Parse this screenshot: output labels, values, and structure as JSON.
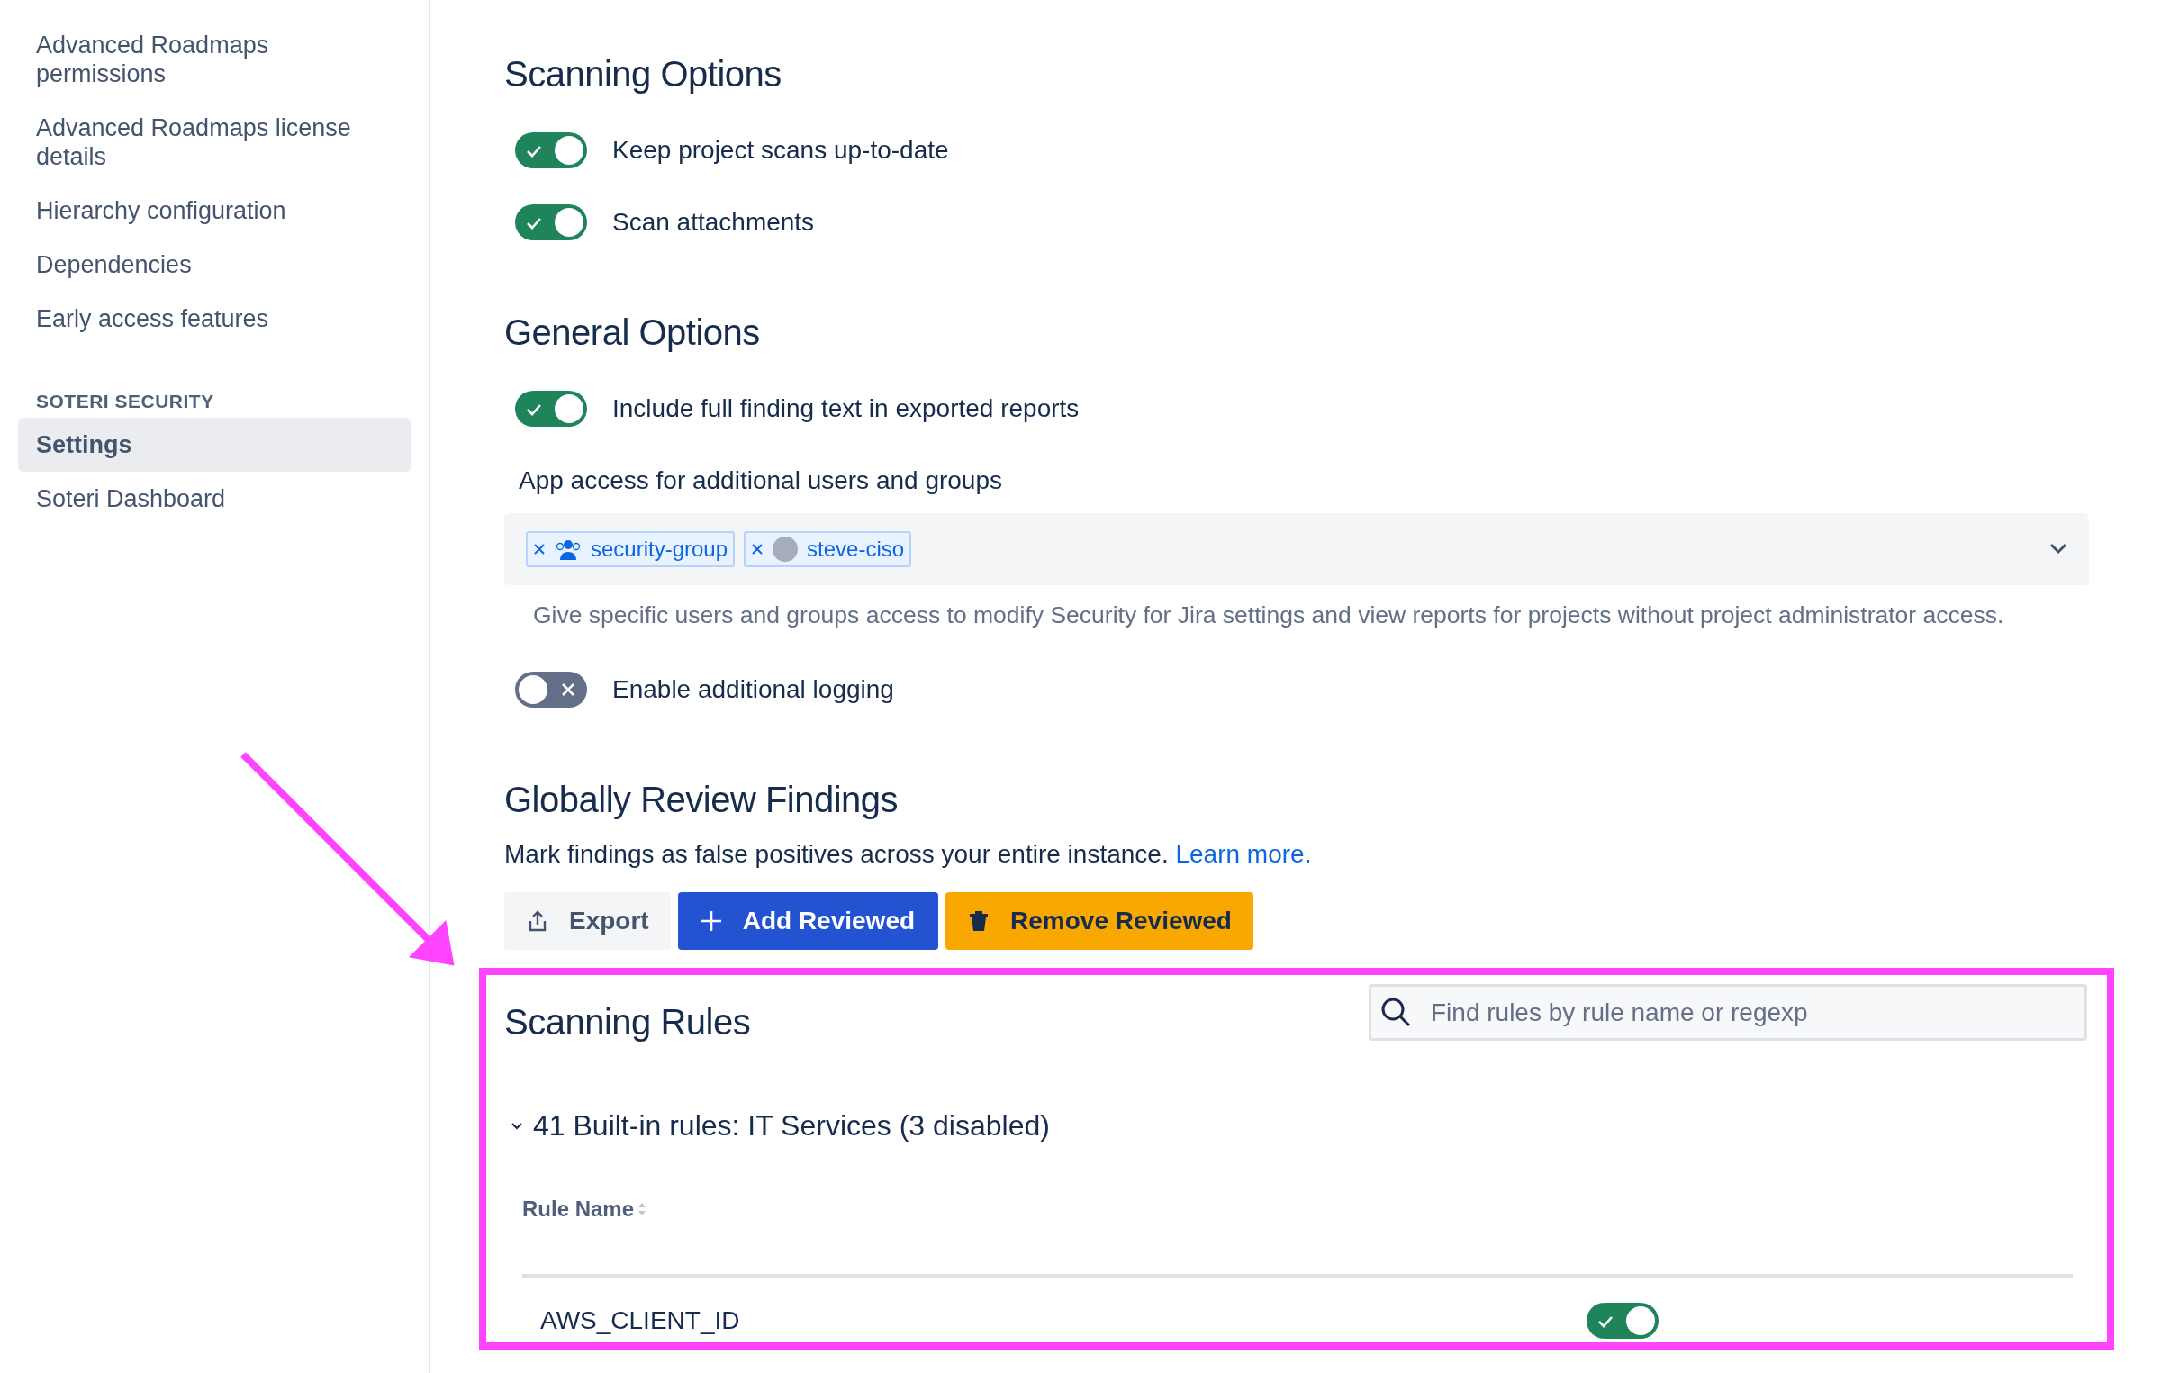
{
  "sidebar": {
    "sections": [
      {
        "items": [
          {
            "label": "Advanced Roadmaps permissions",
            "selected": false
          },
          {
            "label": "Advanced Roadmaps license details",
            "selected": false
          },
          {
            "label": "Hierarchy configuration",
            "selected": false
          },
          {
            "label": "Dependencies",
            "selected": false
          },
          {
            "label": "Early access features",
            "selected": false
          }
        ]
      },
      {
        "heading": "SOTERI SECURITY",
        "items": [
          {
            "label": "Settings",
            "selected": true
          },
          {
            "label": "Soteri Dashboard",
            "selected": false
          }
        ]
      }
    ]
  },
  "scanning_options": {
    "title": "Scanning Options",
    "toggles": [
      {
        "label": "Keep project scans up-to-date",
        "on": true
      },
      {
        "label": "Scan attachments",
        "on": true
      }
    ]
  },
  "general_options": {
    "title": "General Options",
    "toggle": {
      "label": "Include full finding text in exported reports",
      "on": true
    },
    "access": {
      "label": "App access for additional users and groups",
      "tags": [
        {
          "kind": "group",
          "label": "security-group"
        },
        {
          "kind": "user",
          "label": "steve-ciso"
        }
      ],
      "help": "Give specific users and groups access to modify Security for Jira settings and view reports for projects without project administrator access."
    },
    "logging": {
      "label": "Enable additional logging",
      "on": false
    }
  },
  "review": {
    "title": "Globally Review Findings",
    "text": "Mark findings as false positives across your entire instance.",
    "link": "Learn more.",
    "buttons": [
      {
        "kind": "default",
        "label": "Export"
      },
      {
        "kind": "primary",
        "label": "Add Reviewed"
      },
      {
        "kind": "warning",
        "label": "Remove Reviewed"
      }
    ]
  },
  "rules": {
    "title": "Scanning Rules",
    "search": {
      "placeholder": "Find rules by rule name or regexp"
    },
    "group": {
      "title": "41 Built-in rules: IT Services (3 disabled)",
      "expanded": true
    },
    "columns": [
      "Rule Name"
    ],
    "rows": [
      {
        "name": "AWS_CLIENT_ID",
        "enabled": true
      }
    ]
  }
}
